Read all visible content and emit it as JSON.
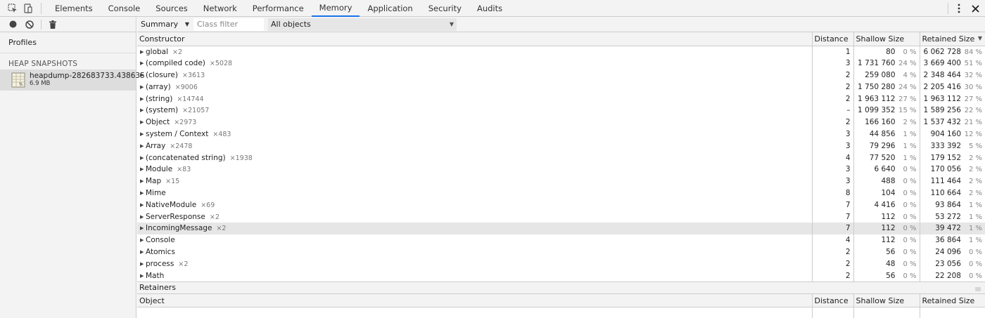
{
  "topbar": {
    "tabs": [
      {
        "label": "Elements",
        "active": false
      },
      {
        "label": "Console",
        "active": false
      },
      {
        "label": "Sources",
        "active": false
      },
      {
        "label": "Network",
        "active": false
      },
      {
        "label": "Performance",
        "active": false
      },
      {
        "label": "Memory",
        "active": true
      },
      {
        "label": "Application",
        "active": false
      },
      {
        "label": "Security",
        "active": false
      },
      {
        "label": "Audits",
        "active": false
      }
    ],
    "accent": "#1a73e8"
  },
  "sidebar": {
    "profiles_title": "Profiles",
    "section_title": "HEAP SNAPSHOTS",
    "snapshot": {
      "name": "heapdump-282683733.438635",
      "size": "6.9 MB"
    }
  },
  "filterbar": {
    "view": "Summary",
    "class_filter_placeholder": "Class filter",
    "objects": "All objects"
  },
  "table": {
    "headers": {
      "constructor": "Constructor",
      "distance": "Distance",
      "shallow": "Shallow Size",
      "retained": "Retained Size"
    },
    "rows": [
      {
        "name": "global",
        "count": "×2",
        "distance": "1",
        "shallow": "80",
        "shallow_pct": "0 %",
        "retained": "6 062 728",
        "retained_pct": "84 %"
      },
      {
        "name": "(compiled code)",
        "count": "×5028",
        "distance": "3",
        "shallow": "1 731 760",
        "shallow_pct": "24 %",
        "retained": "3 669 400",
        "retained_pct": "51 %"
      },
      {
        "name": "(closure)",
        "count": "×3613",
        "distance": "2",
        "shallow": "259 080",
        "shallow_pct": "4 %",
        "retained": "2 348 464",
        "retained_pct": "32 %"
      },
      {
        "name": "(array)",
        "count": "×9006",
        "distance": "2",
        "shallow": "1 750 280",
        "shallow_pct": "24 %",
        "retained": "2 205 416",
        "retained_pct": "30 %"
      },
      {
        "name": "(string)",
        "count": "×14744",
        "distance": "2",
        "shallow": "1 963 112",
        "shallow_pct": "27 %",
        "retained": "1 963 112",
        "retained_pct": "27 %"
      },
      {
        "name": "(system)",
        "count": "×21057",
        "distance": "–",
        "shallow": "1 099 352",
        "shallow_pct": "15 %",
        "retained": "1 589 256",
        "retained_pct": "22 %"
      },
      {
        "name": "Object",
        "count": "×2973",
        "distance": "2",
        "shallow": "166 160",
        "shallow_pct": "2 %",
        "retained": "1 537 432",
        "retained_pct": "21 %"
      },
      {
        "name": "system / Context",
        "count": "×483",
        "distance": "3",
        "shallow": "44 856",
        "shallow_pct": "1 %",
        "retained": "904 160",
        "retained_pct": "12 %"
      },
      {
        "name": "Array",
        "count": "×2478",
        "distance": "3",
        "shallow": "79 296",
        "shallow_pct": "1 %",
        "retained": "333 392",
        "retained_pct": "5 %"
      },
      {
        "name": "(concatenated string)",
        "count": "×1938",
        "distance": "4",
        "shallow": "77 520",
        "shallow_pct": "1 %",
        "retained": "179 152",
        "retained_pct": "2 %"
      },
      {
        "name": "Module",
        "count": "×83",
        "distance": "3",
        "shallow": "6 640",
        "shallow_pct": "0 %",
        "retained": "170 056",
        "retained_pct": "2 %"
      },
      {
        "name": "Map",
        "count": "×15",
        "distance": "3",
        "shallow": "488",
        "shallow_pct": "0 %",
        "retained": "111 464",
        "retained_pct": "2 %"
      },
      {
        "name": "Mime",
        "count": "",
        "distance": "8",
        "shallow": "104",
        "shallow_pct": "0 %",
        "retained": "110 664",
        "retained_pct": "2 %"
      },
      {
        "name": "NativeModule",
        "count": "×69",
        "distance": "7",
        "shallow": "4 416",
        "shallow_pct": "0 %",
        "retained": "93 864",
        "retained_pct": "1 %"
      },
      {
        "name": "ServerResponse",
        "count": "×2",
        "distance": "7",
        "shallow": "112",
        "shallow_pct": "0 %",
        "retained": "53 272",
        "retained_pct": "1 %"
      },
      {
        "name": "IncomingMessage",
        "count": "×2",
        "distance": "7",
        "shallow": "112",
        "shallow_pct": "0 %",
        "retained": "39 472",
        "retained_pct": "1 %",
        "selected": true
      },
      {
        "name": "Console",
        "count": "",
        "distance": "4",
        "shallow": "112",
        "shallow_pct": "0 %",
        "retained": "36 864",
        "retained_pct": "1 %"
      },
      {
        "name": "Atomics",
        "count": "",
        "distance": "2",
        "shallow": "56",
        "shallow_pct": "0 %",
        "retained": "24 096",
        "retained_pct": "0 %"
      },
      {
        "name": "process",
        "count": "×2",
        "distance": "2",
        "shallow": "48",
        "shallow_pct": "0 %",
        "retained": "23 056",
        "retained_pct": "0 %"
      },
      {
        "name": "Math",
        "count": "",
        "distance": "2",
        "shallow": "56",
        "shallow_pct": "0 %",
        "retained": "22 208",
        "retained_pct": "0 %"
      }
    ]
  },
  "retainers": {
    "title": "Retainers",
    "headers": {
      "object": "Object",
      "distance": "Distance",
      "shallow": "Shallow Size",
      "retained": "Retained Size"
    }
  }
}
